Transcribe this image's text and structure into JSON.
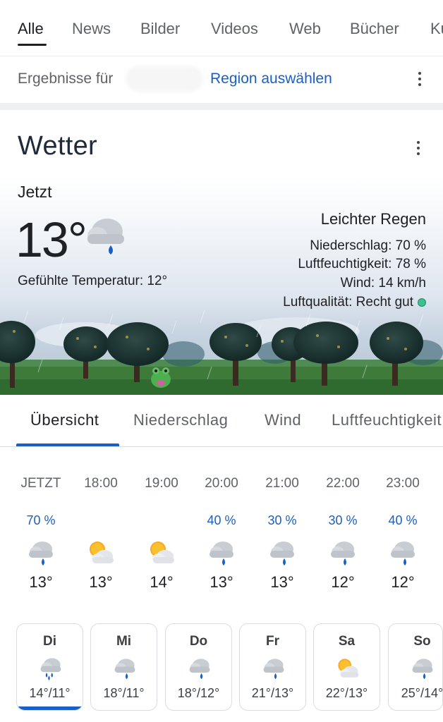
{
  "top_tabs": [
    "Alle",
    "News",
    "Bilder",
    "Videos",
    "Web",
    "Bücher",
    "Ku"
  ],
  "region": {
    "label": "Ergebnisse für",
    "link": "Region auswählen"
  },
  "weather": {
    "title": "Wetter",
    "now_label": "Jetzt",
    "temp": "13°",
    "feels_like": "Gefühlte Temperatur: 12°",
    "condition": "Leichter Regen",
    "precipitation": "Niederschlag: 70 %",
    "humidity": "Luftfeuchtigkeit: 78 %",
    "wind": "Wind: 14 km/h",
    "air_quality": "Luftqualität: Recht gut",
    "air_quality_color": "#3dbf8f"
  },
  "sub_tabs": [
    "Übersicht",
    "Niederschlag",
    "Wind",
    "Luftfeuchtigkeit"
  ],
  "hourly": [
    {
      "time": "JETZT",
      "precip": "70 %",
      "icon": "rain-icon",
      "temp": "13°"
    },
    {
      "time": "18:00",
      "precip": "",
      "icon": "partly-sunny-icon",
      "temp": "13°"
    },
    {
      "time": "19:00",
      "precip": "",
      "icon": "partly-sunny-icon",
      "temp": "14°"
    },
    {
      "time": "20:00",
      "precip": "40 %",
      "icon": "rain-icon",
      "temp": "13°"
    },
    {
      "time": "21:00",
      "precip": "30 %",
      "icon": "rain-icon",
      "temp": "13°"
    },
    {
      "time": "22:00",
      "precip": "30 %",
      "icon": "rain-icon",
      "temp": "12°"
    },
    {
      "time": "23:00",
      "precip": "40 %",
      "icon": "rain-icon",
      "temp": "12°"
    }
  ],
  "daily": [
    {
      "day": "Di",
      "icon": "showers-icon",
      "temps": "14°/11°"
    },
    {
      "day": "Mi",
      "icon": "rain-icon",
      "temps": "18°/11°"
    },
    {
      "day": "Do",
      "icon": "rain-icon",
      "temps": "18°/12°"
    },
    {
      "day": "Fr",
      "icon": "rain-icon",
      "temps": "21°/13°"
    },
    {
      "day": "Sa",
      "icon": "partly-sunny-icon",
      "temps": "22°/13°"
    },
    {
      "day": "So",
      "icon": "rain-icon",
      "temps": "25°/14°"
    }
  ],
  "colors": {
    "accent": "#1a5fc4",
    "title": "#1f2b3a"
  }
}
